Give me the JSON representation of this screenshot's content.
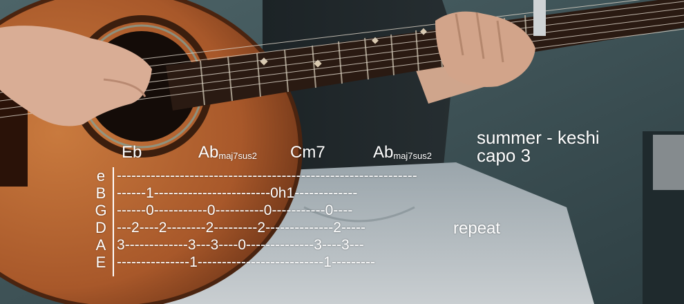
{
  "title": {
    "song": "summer - keshi",
    "capo": "capo 3"
  },
  "chords": [
    {
      "root": "Eb",
      "suffix": ""
    },
    {
      "root": "Ab",
      "suffix": "maj7sus2"
    },
    {
      "root": "Cm7",
      "suffix": ""
    },
    {
      "root": "Ab",
      "suffix": "maj7sus2"
    }
  ],
  "tab": {
    "strings": [
      {
        "name": "e",
        "line": "--------------------------------------------------------------"
      },
      {
        "name": "B",
        "line": "------1------------------------0h1-------------"
      },
      {
        "name": "G",
        "line": "------0-----------0----------0-----------0----"
      },
      {
        "name": "D",
        "line": "---2----2--------2---------2--------------2-----"
      },
      {
        "name": "A",
        "line": "3-------------3---3----0--------------3----3---"
      },
      {
        "name": "E",
        "line": "---------------1--------------------------1---------"
      }
    ],
    "repeat_label": "repeat"
  },
  "colors": {
    "text": "#ffffff",
    "wall": "#3f5559",
    "guitar_body": "#b2632e",
    "neck": "#2a1a12"
  }
}
